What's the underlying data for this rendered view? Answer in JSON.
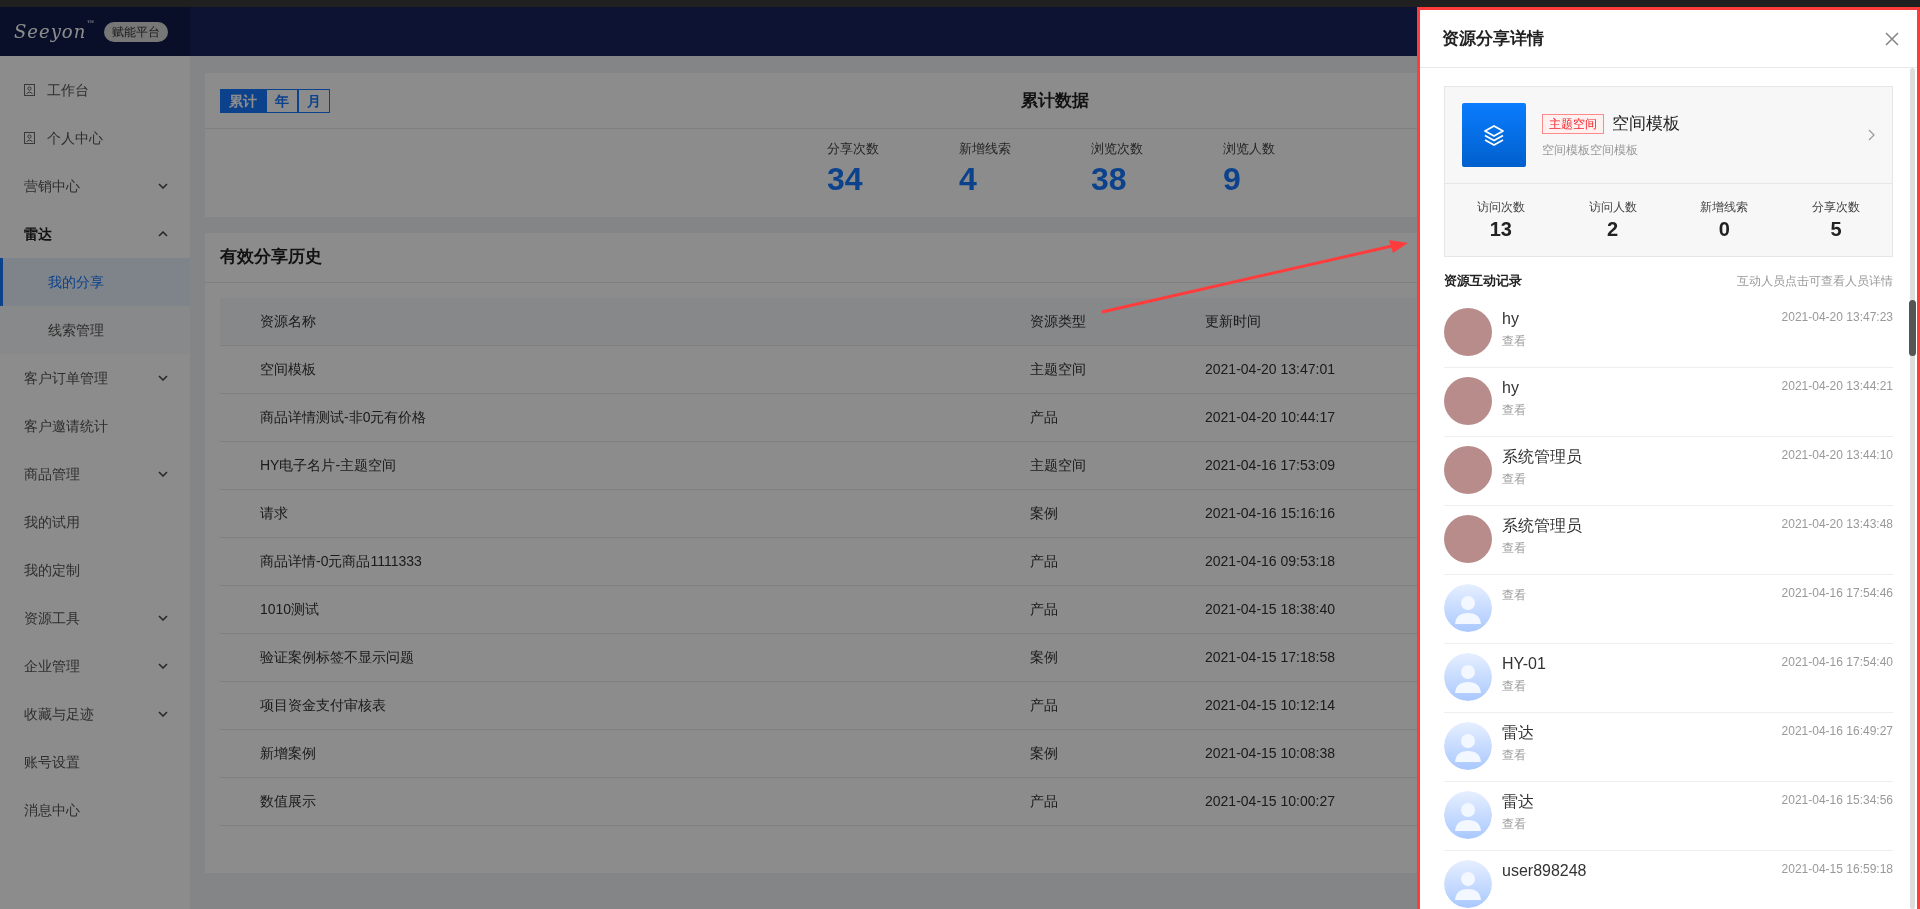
{
  "header": {
    "logo": "Seeyon",
    "logo_mark": "™",
    "platform_badge": "赋能平台"
  },
  "sidebar": {
    "items": [
      {
        "kind": "icon_link",
        "label": "工作台"
      },
      {
        "kind": "icon_link",
        "label": "个人中心"
      },
      {
        "kind": "group",
        "label": "营销中心",
        "expanded": false
      },
      {
        "kind": "group",
        "label": "雷达",
        "expanded": true,
        "children": [
          {
            "label": "我的分享",
            "selected": true
          },
          {
            "label": "线索管理",
            "selected": false
          }
        ]
      },
      {
        "kind": "group",
        "label": "客户订单管理",
        "expanded": false
      },
      {
        "kind": "link",
        "label": "客户邀请统计"
      },
      {
        "kind": "group",
        "label": "商品管理",
        "expanded": false
      },
      {
        "kind": "link",
        "label": "我的试用"
      },
      {
        "kind": "link",
        "label": "我的定制"
      },
      {
        "kind": "group",
        "label": "资源工具",
        "expanded": false
      },
      {
        "kind": "group",
        "label": "企业管理",
        "expanded": false
      },
      {
        "kind": "group",
        "label": "收藏与足迹",
        "expanded": false
      },
      {
        "kind": "link",
        "label": "账号设置"
      },
      {
        "kind": "link",
        "label": "消息中心"
      }
    ]
  },
  "stats": {
    "period_tabs": [
      {
        "label": "累计",
        "selected": true
      },
      {
        "label": "年",
        "selected": false
      },
      {
        "label": "月",
        "selected": false
      }
    ],
    "title": "累计数据",
    "metrics": [
      {
        "label": "分享次数",
        "value": "34"
      },
      {
        "label": "新增线索",
        "value": "4"
      },
      {
        "label": "浏览次数",
        "value": "38"
      },
      {
        "label": "浏览人数",
        "value": "9"
      }
    ]
  },
  "history": {
    "title": "有效分享历史",
    "columns": [
      "资源名称",
      "资源类型",
      "更新时间"
    ],
    "rows": [
      {
        "name": "空间模板",
        "type": "主题空间",
        "time": "2021-04-20 13:47:01"
      },
      {
        "name": "商品详情测试-非0元有价格",
        "type": "产品",
        "time": "2021-04-20 10:44:17"
      },
      {
        "name": "HY电子名片-主题空间",
        "type": "主题空间",
        "time": "2021-04-16 17:53:09"
      },
      {
        "name": "请求",
        "type": "案例",
        "time": "2021-04-16 15:16:16"
      },
      {
        "name": "商品详情-0元商品1111333",
        "type": "产品",
        "time": "2021-04-16 09:53:18"
      },
      {
        "name": "1010测试",
        "type": "产品",
        "time": "2021-04-15 18:38:40"
      },
      {
        "name": "验证案例标签不显示问题",
        "type": "案例",
        "time": "2021-04-15 17:18:58"
      },
      {
        "name": "项目资金支付审核表",
        "type": "产品",
        "time": "2021-04-15 10:12:14"
      },
      {
        "name": "新增案例",
        "type": "案例",
        "time": "2021-04-15 10:08:38"
      },
      {
        "name": "数值展示",
        "type": "产品",
        "time": "2021-04-15 10:00:27"
      }
    ]
  },
  "drawer": {
    "title": "资源分享详情",
    "resource": {
      "tag": "主题空间",
      "name": "空间模板",
      "description": "空间模板空间模板"
    },
    "metrics": [
      {
        "label": "访问次数",
        "value": "13"
      },
      {
        "label": "访问人数",
        "value": "2"
      },
      {
        "label": "新增线索",
        "value": "0"
      },
      {
        "label": "分享次数",
        "value": "5"
      }
    ],
    "records_title": "资源互动记录",
    "records_hint": "互动人员点击可查看人员详情",
    "records": [
      {
        "kind": "photo",
        "name": "hy",
        "action": "查看",
        "time": "2021-04-20 13:47:23"
      },
      {
        "kind": "photo",
        "name": "hy",
        "action": "查看",
        "time": "2021-04-20 13:44:21"
      },
      {
        "kind": "photo",
        "name": "系统管理员",
        "action": "查看",
        "time": "2021-04-20 13:44:10"
      },
      {
        "kind": "photo",
        "name": "系统管理员",
        "action": "查看",
        "time": "2021-04-20 13:43:48"
      },
      {
        "kind": "default",
        "action": "查看",
        "time": "2021-04-16 17:54:46"
      },
      {
        "kind": "default",
        "name": "HY-01",
        "action": "查看",
        "time": "2021-04-16 17:54:40"
      },
      {
        "kind": "default",
        "name": "雷达",
        "action": "查看",
        "time": "2021-04-16 16:49:27"
      },
      {
        "kind": "default",
        "name": "雷达",
        "action": "查看",
        "time": "2021-04-16 15:34:56"
      },
      {
        "kind": "default",
        "name": "user898248",
        "time": "2021-04-15 16:59:18"
      }
    ]
  }
}
